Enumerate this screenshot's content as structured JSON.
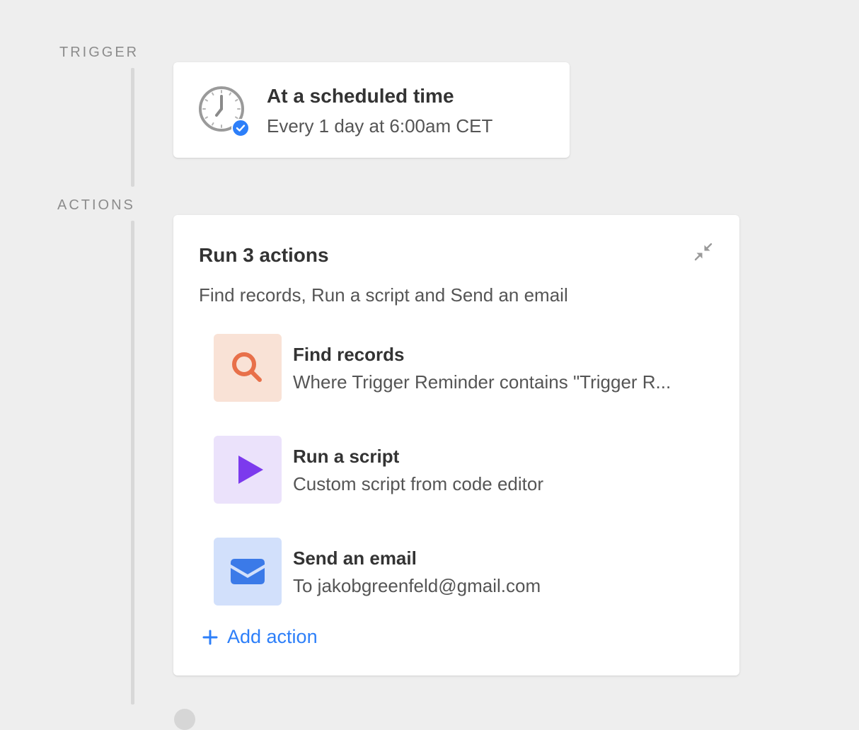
{
  "trigger": {
    "section_label": "TRIGGER",
    "title": "At a scheduled time",
    "subtitle": "Every 1 day at 6:00am CET",
    "icon": "clock-icon",
    "badge_icon": "check-badge-icon"
  },
  "actions": {
    "section_label": "ACTIONS",
    "title": "Run 3 actions",
    "summary": "Find records, Run a script and Send an email",
    "collapse_icon": "collapse-icon",
    "items": [
      {
        "name": "Find records",
        "description": "Where Trigger Reminder contains \"Trigger R...",
        "icon": "search-icon",
        "tile_color": "#f9e2d6",
        "icon_color": "#e8704a"
      },
      {
        "name": "Run a script",
        "description": "Custom script from code editor",
        "icon": "play-icon",
        "tile_color": "#ebe2fb",
        "icon_color": "#7c3aed"
      },
      {
        "name": "Send an email",
        "description": "To jakobgreenfeld@gmail.com",
        "icon": "envelope-icon",
        "tile_color": "#d2e0fb",
        "icon_color": "#3b7ae8"
      }
    ],
    "add_action_label": "Add action"
  },
  "colors": {
    "background": "#eeeeee",
    "accent": "#2d7ff9",
    "label_gray": "#8c8c8c",
    "rail": "#d8d8d8"
  }
}
